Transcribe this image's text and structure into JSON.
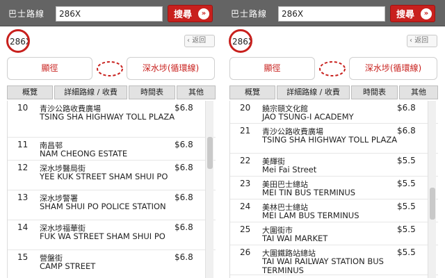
{
  "panels": [
    {
      "header_label": "巴士路線",
      "search_value": "286X",
      "search_button": "搜尋",
      "search_arrow": "»",
      "route_badge": "286X",
      "back_label": "返回",
      "back_arrow": "‹",
      "direction_from": "顯徑",
      "direction_to": "深水埗(循環線)",
      "tabs": [
        "概覽",
        "詳細路線 / 收費",
        "時間表",
        "其他"
      ],
      "active_tab": 1,
      "scroll_fraction": 0.25,
      "stops": [
        {
          "num": "10",
          "zh": "青沙公路收費廣場",
          "en": "TSING SHA HIGHWAY TOLL PLAZA",
          "fare": "$6.8"
        },
        {
          "num": "11",
          "zh": "南昌邨",
          "en": "NAM CHEONG ESTATE",
          "fare": "$6.8"
        },
        {
          "num": "12",
          "zh": "深水埗醫局街",
          "en": "YEE KUK STREET SHAM SHUI PO",
          "fare": "$6.8"
        },
        {
          "num": "13",
          "zh": "深水埗警署",
          "en": "SHAM SHUI PO POLICE STATION",
          "fare": "$6.8"
        },
        {
          "num": "14",
          "zh": "深水埗福華街",
          "en": "FUK WA STREET SHAM SHUI PO",
          "fare": "$6.8"
        },
        {
          "num": "15",
          "zh": "營盤街",
          "en": "CAMP STREET",
          "fare": "$6.8"
        }
      ]
    },
    {
      "header_label": "巴士路線",
      "search_value": "286X",
      "search_button": "搜尋",
      "search_arrow": "»",
      "route_badge": "286X",
      "back_label": "返回",
      "back_arrow": "‹",
      "direction_from": "顯徑",
      "direction_to": "深水埗(循環線)",
      "tabs": [
        "概覽",
        "詳細路線 / 收費",
        "時間表",
        "其他"
      ],
      "active_tab": 1,
      "scroll_fraction": 0.6,
      "stops": [
        {
          "num": "20",
          "zh": "饒宗頤文化館",
          "en": "JAO TSUNG-I ACADEMY",
          "fare": "$6.8"
        },
        {
          "num": "21",
          "zh": "青沙公路收費廣場",
          "en": "TSING SHA HIGHWAY TOLL PLAZA",
          "fare": "$6.8"
        },
        {
          "num": "22",
          "zh": "美輝街",
          "en": "Mei Fai Street",
          "fare": "$5.5"
        },
        {
          "num": "23",
          "zh": "美田巴士總站",
          "en": "MEI TIN BUS TERMINUS",
          "fare": "$5.5"
        },
        {
          "num": "24",
          "zh": "美林巴士總站",
          "en": "MEI LAM BUS TERMINUS",
          "fare": "$5.5"
        },
        {
          "num": "25",
          "zh": "大圍街市",
          "en": "TAI WAI MARKET",
          "fare": "$5.5"
        },
        {
          "num": "26",
          "zh": "大圍鐵路站總站",
          "en": "TAI WAI RAILWAY STATION BUS TERMINUS",
          "fare": "$5.5"
        }
      ]
    }
  ]
}
